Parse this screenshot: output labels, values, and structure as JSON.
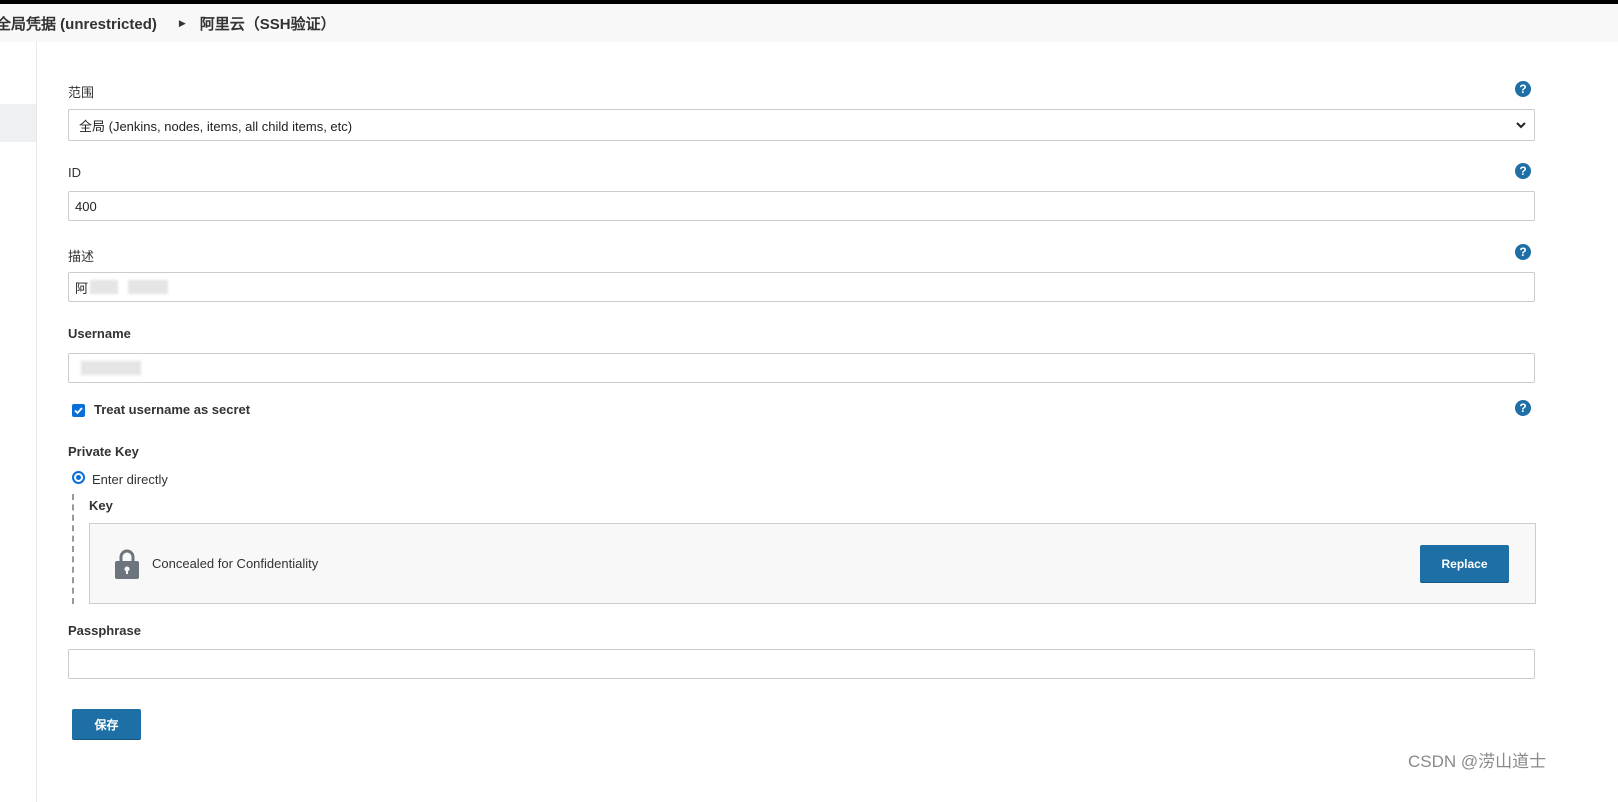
{
  "breadcrumb": {
    "items": [
      "全局凭据 (unrestricted)",
      "阿里云（SSH验证）"
    ]
  },
  "form": {
    "scope": {
      "label": "范围",
      "selected": "全局 (Jenkins, nodes, items, all child items, etc)"
    },
    "id": {
      "label": "ID",
      "value": "400"
    },
    "description": {
      "label": "描述",
      "value_visible": "阿"
    },
    "username": {
      "label": "Username",
      "value": ""
    },
    "treat_username_secret": {
      "label": "Treat username as secret",
      "checked": true
    },
    "private_key": {
      "label": "Private Key",
      "option_label": "Enter directly",
      "selected": true,
      "key_label": "Key",
      "concealed_text": "Concealed for Confidentiality",
      "replace_label": "Replace"
    },
    "passphrase": {
      "label": "Passphrase",
      "value": ""
    },
    "save_label": "保存"
  },
  "help_icon_glyph": "?",
  "watermark": "CSDN @涝山道士",
  "colors": {
    "primary": "#1d6fa5",
    "checkbox": "#0b6fd8",
    "breadcrumb_bg": "#f8f8f8"
  },
  "icons": [
    "help-icon",
    "chevron-down-icon",
    "checkmark-icon",
    "lock-icon",
    "breadcrumb-arrow-icon"
  ]
}
